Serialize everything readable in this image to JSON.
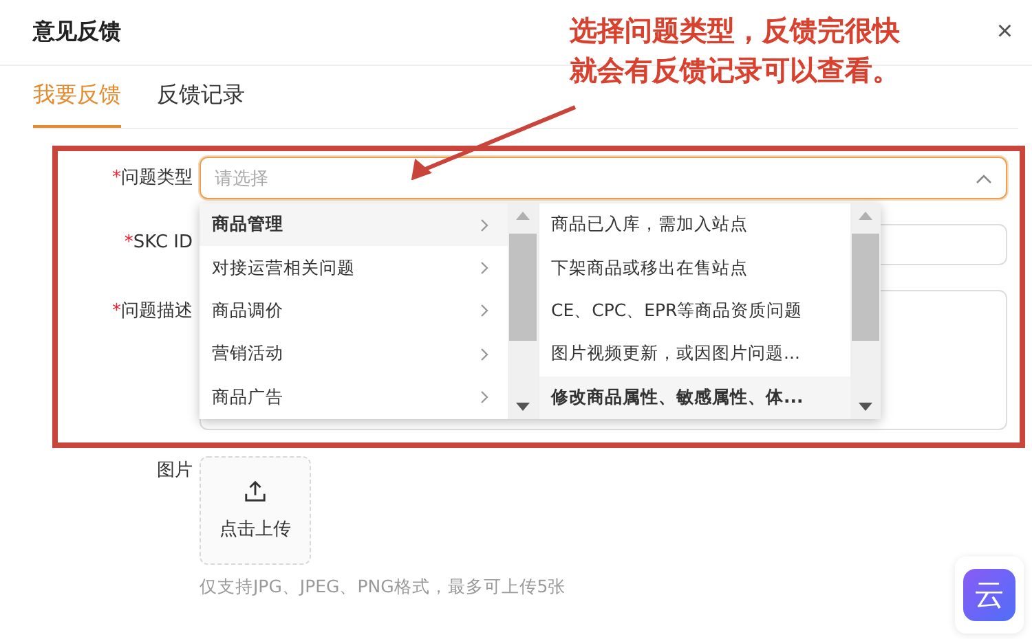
{
  "dialog": {
    "title": "意见反馈",
    "close": "×"
  },
  "tabs": [
    {
      "label": "我要反馈",
      "selected": true
    },
    {
      "label": "反馈记录",
      "selected": false
    }
  ],
  "form": {
    "fields": [
      {
        "kind": "select",
        "label": "问题类型",
        "required_mark": "*",
        "placeholder": "请选择",
        "open": true
      },
      {
        "kind": "input",
        "label": "SKC ID",
        "required_mark": "*"
      },
      {
        "kind": "textarea",
        "label": "问题描述",
        "required_mark": "*"
      }
    ],
    "dropdown": {
      "categories": [
        {
          "label": "商品管理",
          "selected": true
        },
        {
          "label": "对接运营相关问题",
          "selected": false
        },
        {
          "label": "商品调价",
          "selected": false
        },
        {
          "label": "营销活动",
          "selected": false
        },
        {
          "label": "商品广告",
          "selected": false
        }
      ],
      "subcategories": [
        {
          "label": "商品已入库，需加入站点",
          "selected": false
        },
        {
          "label": "下架商品或移出在售站点",
          "selected": false
        },
        {
          "label": "CE、CPC、EPR等商品资质问题",
          "selected": false
        },
        {
          "label": "图片视频更新，或因图片问题...",
          "selected": false
        },
        {
          "label": "修改商品属性、敏感属性、体...",
          "selected": true
        }
      ]
    },
    "upload": {
      "label": "图片",
      "button": "点击上传",
      "hint": "仅支持JPG、JPEG、PNG格式，最多可上传5张"
    }
  },
  "annotation": {
    "lines": [
      "选择问题类型，反馈完很快",
      "就会有反馈记录可以查看。"
    ]
  },
  "assistant_button": "云"
}
